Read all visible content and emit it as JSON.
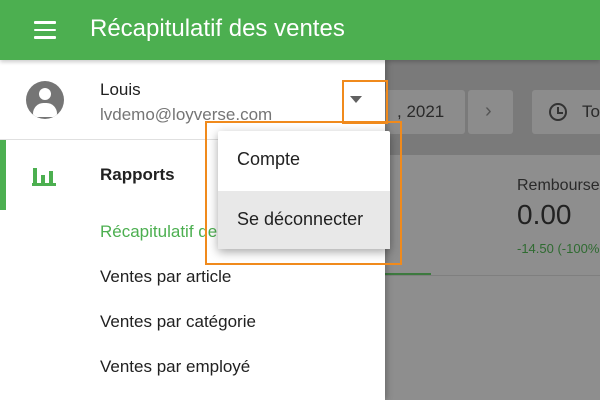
{
  "header": {
    "title": "Récapitulatif des ventes"
  },
  "background": {
    "date_text": ", 2021",
    "time_text": "To",
    "refunds_label": "Rembourse",
    "refunds_value": "0.00",
    "refunds_change": "-14.50 (-100%"
  },
  "drawer": {
    "user": {
      "name": "Louis",
      "email": "lvdemo@loyverse.com"
    },
    "reports_label": "Rapports",
    "sub_items": [
      "Récapitulatif de",
      "Ventes par article",
      "Ventes par catégorie",
      "Ventes par employé"
    ]
  },
  "popup": {
    "items": [
      "Compte",
      "Se déconnecter"
    ]
  },
  "colors": {
    "brand": "#4caf50",
    "highlight": "#f08a1c"
  }
}
